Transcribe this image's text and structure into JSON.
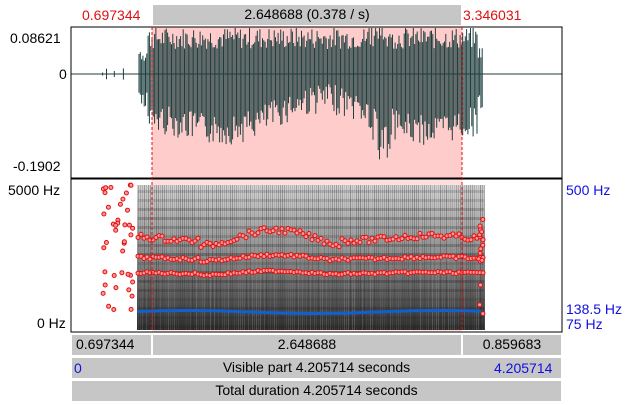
{
  "selection": {
    "start": "0.697344",
    "end": "3.346031",
    "duration_label": "2.648688 (0.378 / s)"
  },
  "waveform": {
    "max_label": "0.08621",
    "zero_label": "0",
    "min_label": "-0.1902"
  },
  "spectrogram": {
    "freq_top_label": "5000 Hz",
    "freq_bottom_label": "0 Hz",
    "formant_max_label": "500 Hz",
    "pitch_cursor_label": "138.5 Hz",
    "pitch_floor_label": "75 Hz"
  },
  "bottom_bar": {
    "left_segment": "0.697344",
    "middle_segment": "2.648688",
    "right_segment": "0.859683",
    "visible_start": "0",
    "visible_label": "Visible part 4.205714 seconds",
    "visible_end": "4.205714",
    "total_label": "Total duration 4.205714 seconds"
  },
  "colors": {
    "selection_fill": "#ffcccc",
    "waveform": "#1f3f3f",
    "formant_red": "#e01010",
    "pitch_blue": "#1060d0",
    "bar_gray": "#c6c6c6"
  }
}
